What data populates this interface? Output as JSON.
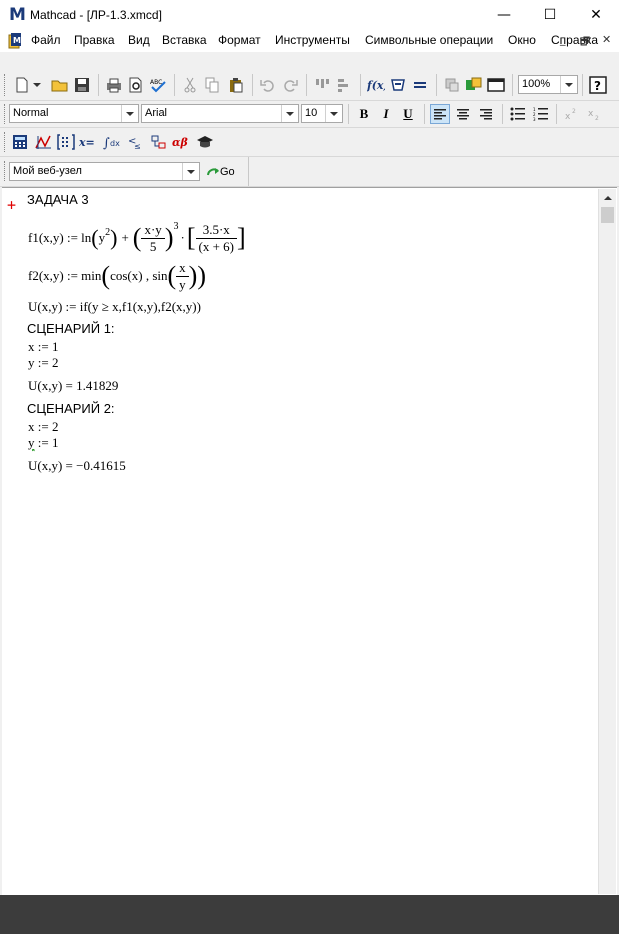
{
  "window": {
    "title": "Mathcad - [ЛР-1.3.xmcd]",
    "minimize": "—",
    "maximize": "☐",
    "close": "✕"
  },
  "menu": [
    "Файл",
    "Правка",
    "Вид",
    "Вставка",
    "Формат",
    "Инструменты",
    "Символьные операции",
    "Окно",
    "Справка"
  ],
  "mdi": {
    "minimize": "_",
    "restore": "🗗",
    "close": "✕"
  },
  "toolbar": {
    "zoom": "100%"
  },
  "format_bar": {
    "style": "Normal",
    "font": "Arial",
    "size": "10",
    "bold": "B",
    "italic": "I",
    "underline": "U"
  },
  "resources_bar": {
    "resource": "Мой веб-узел",
    "go": "Go"
  },
  "worksheet": {
    "heading": "ЗАДАЧА 3",
    "f1_def": {
      "lhs": "f1(x,y) := ln",
      "y2_base": "y",
      "exp2": "2",
      "plus": "+",
      "num1": "x·y",
      "den1": "5",
      "exp3": "3",
      "dot": "·",
      "num2": "3.5·x",
      "den2": "(x + 6)"
    },
    "f2_def": {
      "lhs": "f2(x,y) := min",
      "cos": "cos(x) , sin",
      "num": "x",
      "den": "y"
    },
    "u_def": "U(x,y) := if(y ≥ x,f1(x,y),f2(x,y))",
    "s1_title": "СЦЕНАРИЙ 1:",
    "s1_x": "x := 1",
    "s1_y": "y := 2",
    "s1_result": "U(x,y) = 1.41829",
    "s2_title": "СЦЕНАРИЙ 2:",
    "s2_x": "x := 2",
    "s2_y_var": "y",
    "s2_y_rest": " := 1",
    "s2_result": "U(x,y) = −0.41615"
  }
}
